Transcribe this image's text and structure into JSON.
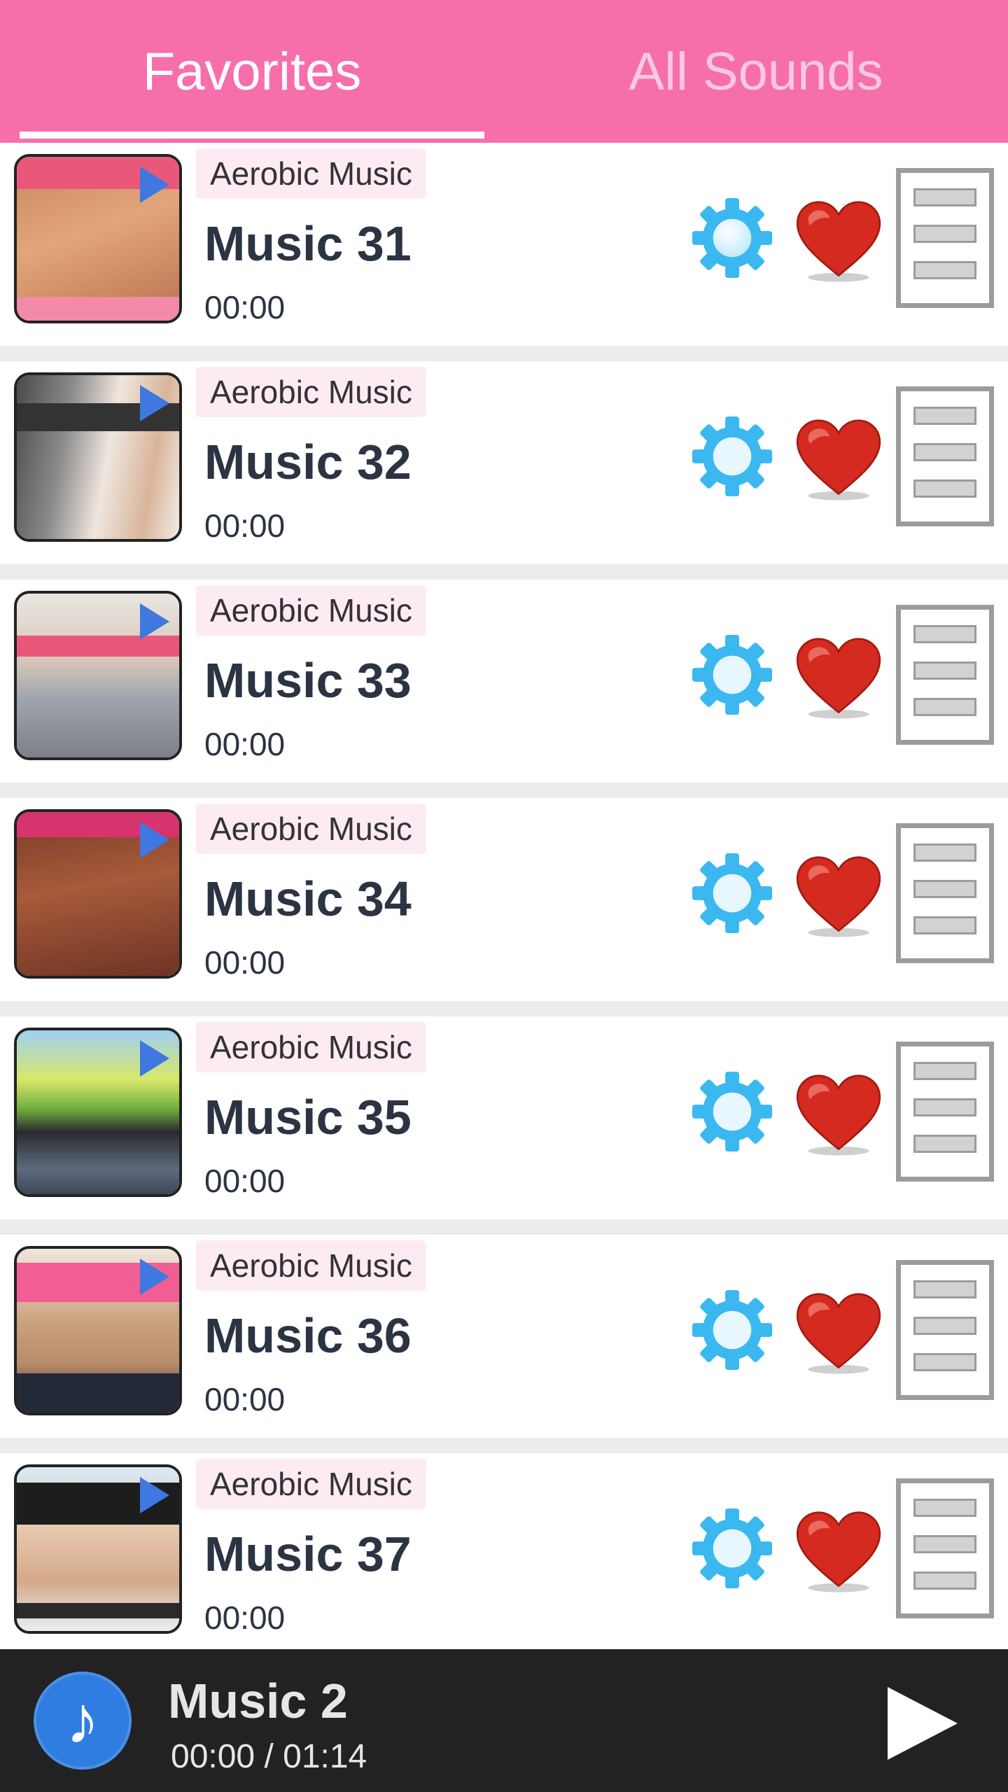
{
  "tabs": {
    "favorites_label": "Favorites",
    "all_sounds_label": "All Sounds",
    "active": "Favorites"
  },
  "list": {
    "items": [
      {
        "category": "Aerobic Music",
        "title": "Music 31",
        "duration": "00:00"
      },
      {
        "category": "Aerobic Music",
        "title": "Music 32",
        "duration": "00:00"
      },
      {
        "category": "Aerobic Music",
        "title": "Music 33",
        "duration": "00:00"
      },
      {
        "category": "Aerobic Music",
        "title": "Music 34",
        "duration": "00:00"
      },
      {
        "category": "Aerobic Music",
        "title": "Music 35",
        "duration": "00:00"
      },
      {
        "category": "Aerobic Music",
        "title": "Music 36",
        "duration": "00:00"
      },
      {
        "category": "Aerobic Music",
        "title": "Music 37",
        "duration": "00:00"
      }
    ]
  },
  "player": {
    "now_playing_title": "Music 2",
    "time_display": "00:00 / 01:14",
    "note_icon": "music-note-icon",
    "play_icon": "play-icon"
  },
  "colors": {
    "header": "#f66fab",
    "player_bar": "#222222",
    "accent_blue": "#2f7de0",
    "heart_red": "#d42a1f",
    "gear_blue": "#3ab8ef"
  }
}
